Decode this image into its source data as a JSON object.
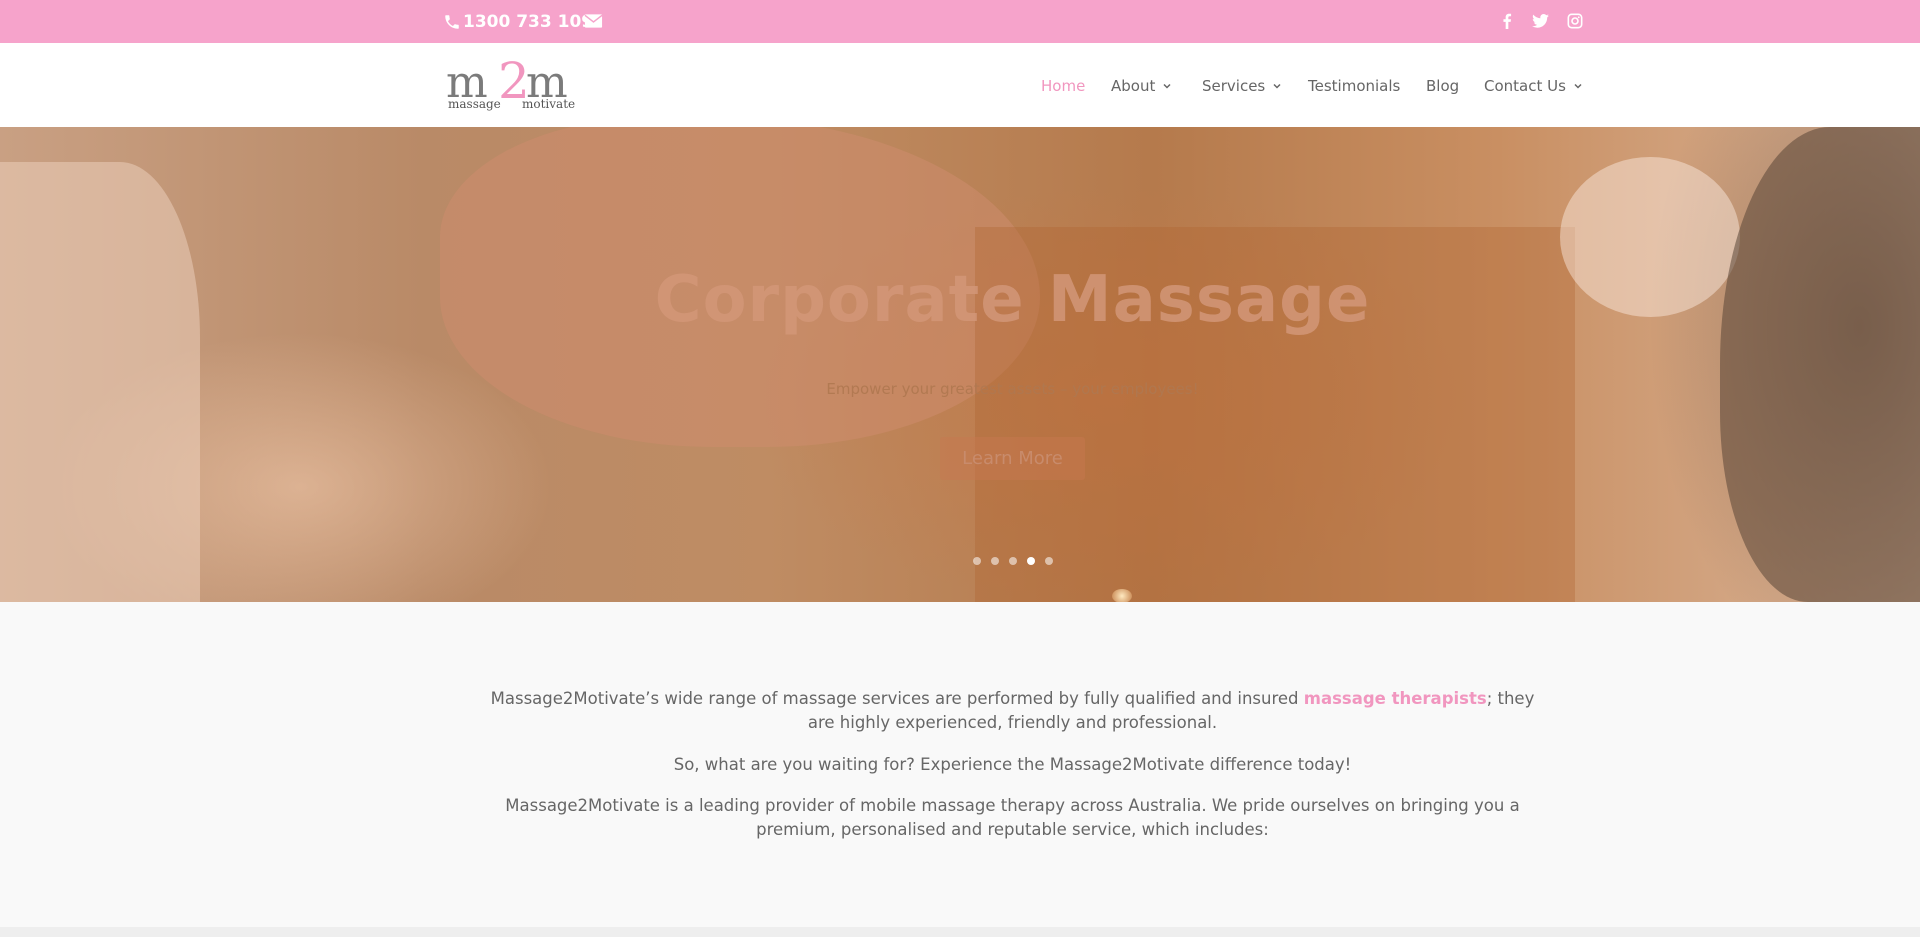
{
  "topbar": {
    "phone": "1300 733 109",
    "icons": [
      "phone-icon",
      "email-icon",
      "facebook-icon",
      "twitter-icon",
      "instagram-icon"
    ],
    "background": "#f6a3cb"
  },
  "logo": {
    "text": "m2m",
    "left_m": "m",
    "digit": "2",
    "right_m": "m",
    "word_left": "massage",
    "word_right": "motivate"
  },
  "nav": {
    "items": [
      {
        "label": "Home",
        "active": true
      },
      {
        "label": "About",
        "dropdown": true
      },
      {
        "label": "Services",
        "dropdown": true
      },
      {
        "label": "Testimonials"
      },
      {
        "label": "Blog"
      },
      {
        "label": "Contact Us",
        "dropdown": true
      }
    ],
    "accent": "#f196bf"
  },
  "hero": {
    "title": "Corporate Massage",
    "subtitle": "Empower your greatest assets – your employees!",
    "button": "Learn More",
    "slide_count": 5,
    "active_slide": 4
  },
  "content": {
    "p1_before": "Massage2Motivate’s wide range of massage services are performed by fully qualified and insured ",
    "p1_link": "massage therapists",
    "p1_after": "; they are highly experienced, friendly and professional.",
    "p2": "So, what are you waiting for? Experience the Massage2Motivate difference today!",
    "p3": "Massage2Motivate is a leading provider of mobile massage therapy across Australia. We pride ourselves on bringing you a premium, personalised and reputable service, which includes:"
  }
}
